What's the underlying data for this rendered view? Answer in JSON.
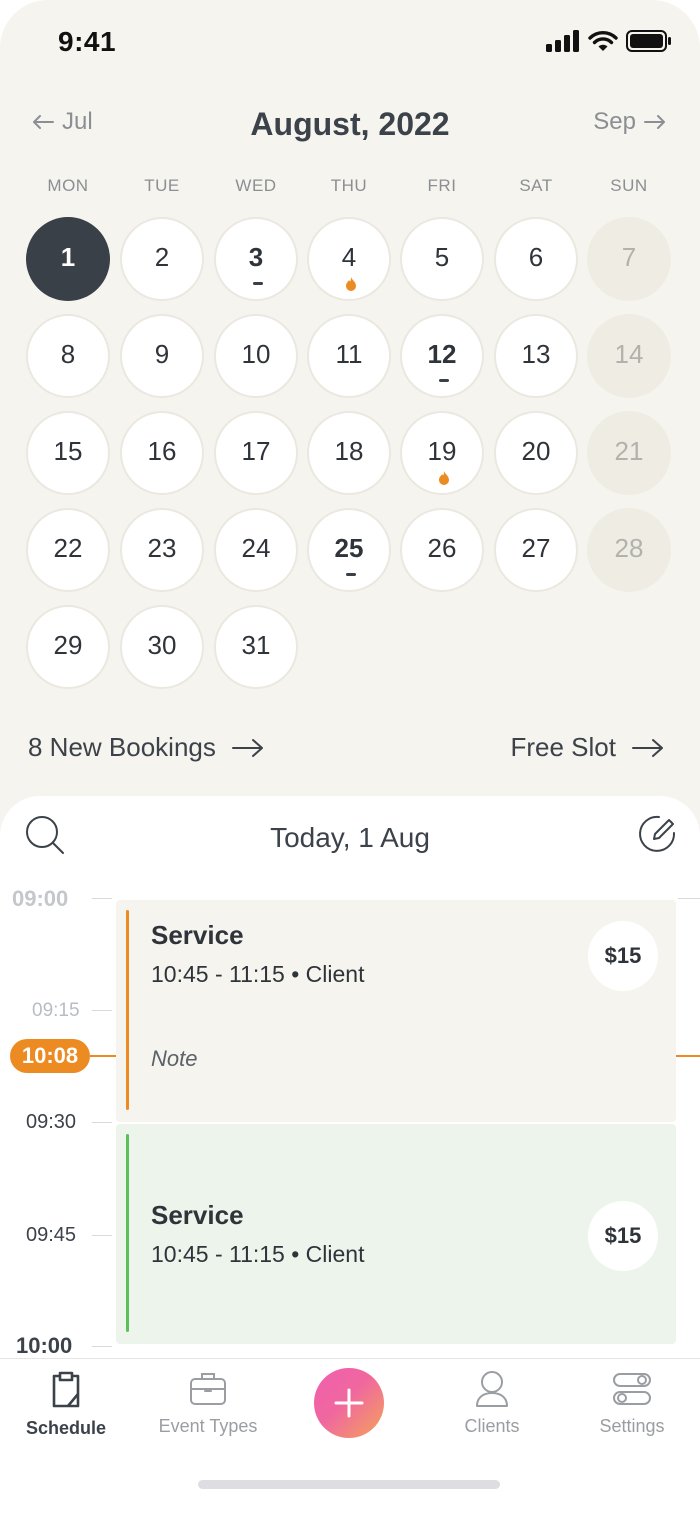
{
  "status_bar": {
    "time": "9:41"
  },
  "calendar": {
    "prev_month": "Jul",
    "next_month": "Sep",
    "title": "August, 2022",
    "weekdays": [
      "MON",
      "TUE",
      "WED",
      "THU",
      "FRI",
      "SAT",
      "SUN"
    ],
    "days": [
      "1",
      "2",
      "3",
      "4",
      "5",
      "6",
      "7",
      "8",
      "9",
      "10",
      "11",
      "12",
      "13",
      "14",
      "15",
      "16",
      "17",
      "18",
      "19",
      "20",
      "21",
      "22",
      "23",
      "24",
      "25",
      "26",
      "27",
      "28",
      "29",
      "30",
      "31"
    ],
    "selected_day": "1",
    "days_with_bookings": [
      "3",
      "12",
      "25"
    ],
    "days_with_flame": [
      "4",
      "19"
    ]
  },
  "summary": {
    "new_bookings": "8 New Bookings",
    "free_slot": "Free Slot"
  },
  "day_view": {
    "title": "Today, 1 Aug",
    "times": {
      "t0900": "09:00",
      "t0915": "09:15",
      "t0930": "09:30",
      "t0945": "09:45",
      "t1000": "10:00"
    },
    "now": "10:08",
    "events": [
      {
        "title": "Service",
        "meta": "10:45 - 11:15 • Client",
        "note": "Note",
        "price": "$15",
        "accent": "#ec8b22",
        "bg": "#f6f4ef"
      },
      {
        "title": "Service",
        "meta": "10:45 - 11:15 • Client",
        "price": "$15",
        "accent": "#5cc05a",
        "bg": "#ecf4ec"
      }
    ]
  },
  "tabs": {
    "schedule": "Schedule",
    "event_types": "Event Types",
    "clients": "Clients",
    "settings": "Settings"
  },
  "colors": {
    "accent_orange": "#ec8b22",
    "dark": "#3a4048",
    "fab_pink": "#f15fb0",
    "fab_orange": "#f4a35a"
  }
}
